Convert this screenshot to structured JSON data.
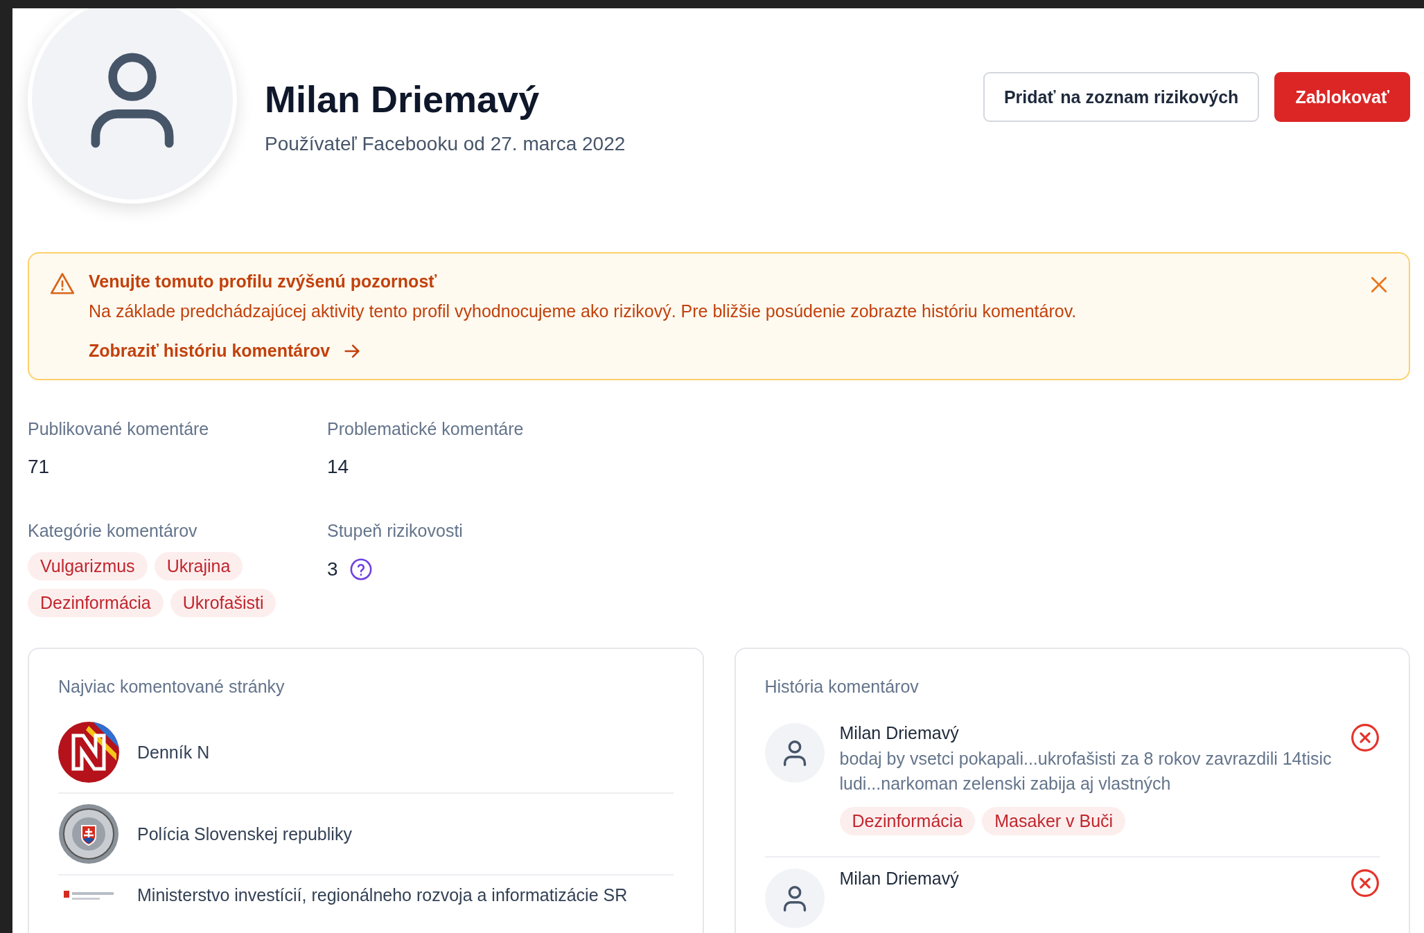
{
  "profile": {
    "name": "Milan Driemavý",
    "subtitle": "Používateľ Facebooku od 27. marca 2022"
  },
  "actions": [
    {
      "label": "Pridať na zoznam rizikových",
      "kind": "secondary"
    },
    {
      "label": "Zablokovať",
      "kind": "danger"
    }
  ],
  "alert": {
    "title": "Venujte tomuto profilu zvýšenú pozornosť",
    "message": "Na základe predchádzajúcej aktivity tento profil vyhodnocujeme ako rizikový. Pre bližšie posúdenie zobrazte históriu komentárov.",
    "link": "Zobraziť históriu komentárov"
  },
  "stats": [
    {
      "label": "Publikované komentáre",
      "value": "71"
    },
    {
      "label": "Problematické komentáre",
      "value": "14"
    }
  ],
  "categories": {
    "label": "Kategórie komentárov",
    "tags": [
      "Vulgarizmus",
      "Ukrajina",
      "Dezinformácia",
      "Ukrofašisti"
    ]
  },
  "risk": {
    "label": "Stupeň rizikovosti",
    "value": "3"
  },
  "top_pages": {
    "title": "Najviac komentované stránky",
    "items": [
      {
        "name": "Denník N",
        "kind": "letter"
      },
      {
        "name": "Polícia Slovenskej republiky",
        "kind": "badge"
      },
      {
        "name": "Ministerstvo investícií, regionálneho rozvoja a informatizácie SR",
        "kind": "emblem"
      }
    ]
  },
  "history": {
    "title": "História komentárov",
    "items": [
      {
        "author": "Milan Driemavý",
        "text": "bodaj by vsetci pokapali...ukrofašisti za 8 rokov zavrazdili 14tisic ludi...narkoman zelenski zabija aj vlastných",
        "tags": [
          "Dezinformácia",
          "Masaker v Buči"
        ]
      },
      {
        "author": "Milan Driemavý"
      }
    ]
  }
}
